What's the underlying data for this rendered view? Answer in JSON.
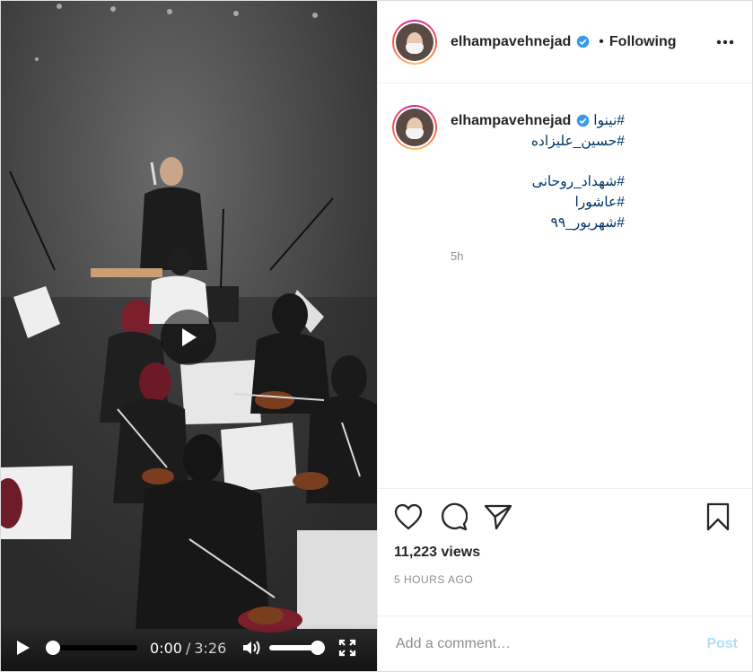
{
  "post": {
    "author": {
      "username": "elhampavehnejad",
      "verified": true,
      "following_label": "Following",
      "separator": "•"
    },
    "caption": {
      "username": "elhampavehnejad",
      "hashtags_line1": "#نینوا",
      "hashtags_line2": "#حسین_علیزاده",
      "hashtags_block": [
        "#شهداد_روحانی",
        "#عاشورا",
        "#شهریور_۹۹"
      ],
      "age": "5h"
    },
    "stats": {
      "views": "11,223 views",
      "time_ago": "5 HOURS AGO"
    },
    "comment": {
      "placeholder": "Add a comment…",
      "post_label": "Post"
    }
  },
  "video": {
    "current_time": "0:00",
    "time_separator": "/",
    "duration": "3:26",
    "progress": 0,
    "volume": 1
  },
  "icons": {
    "verified": "verified-badge-icon",
    "more": "more-options-icon",
    "like": "heart-icon",
    "comment": "comment-icon",
    "share": "share-icon",
    "save": "bookmark-icon",
    "play": "play-icon",
    "volume": "volume-icon",
    "fullscreen": "fullscreen-icon"
  },
  "colors": {
    "link": "#00376b",
    "muted": "#8e8e8e",
    "post_disabled": "#b2dffc",
    "verified": "#3897f0"
  }
}
